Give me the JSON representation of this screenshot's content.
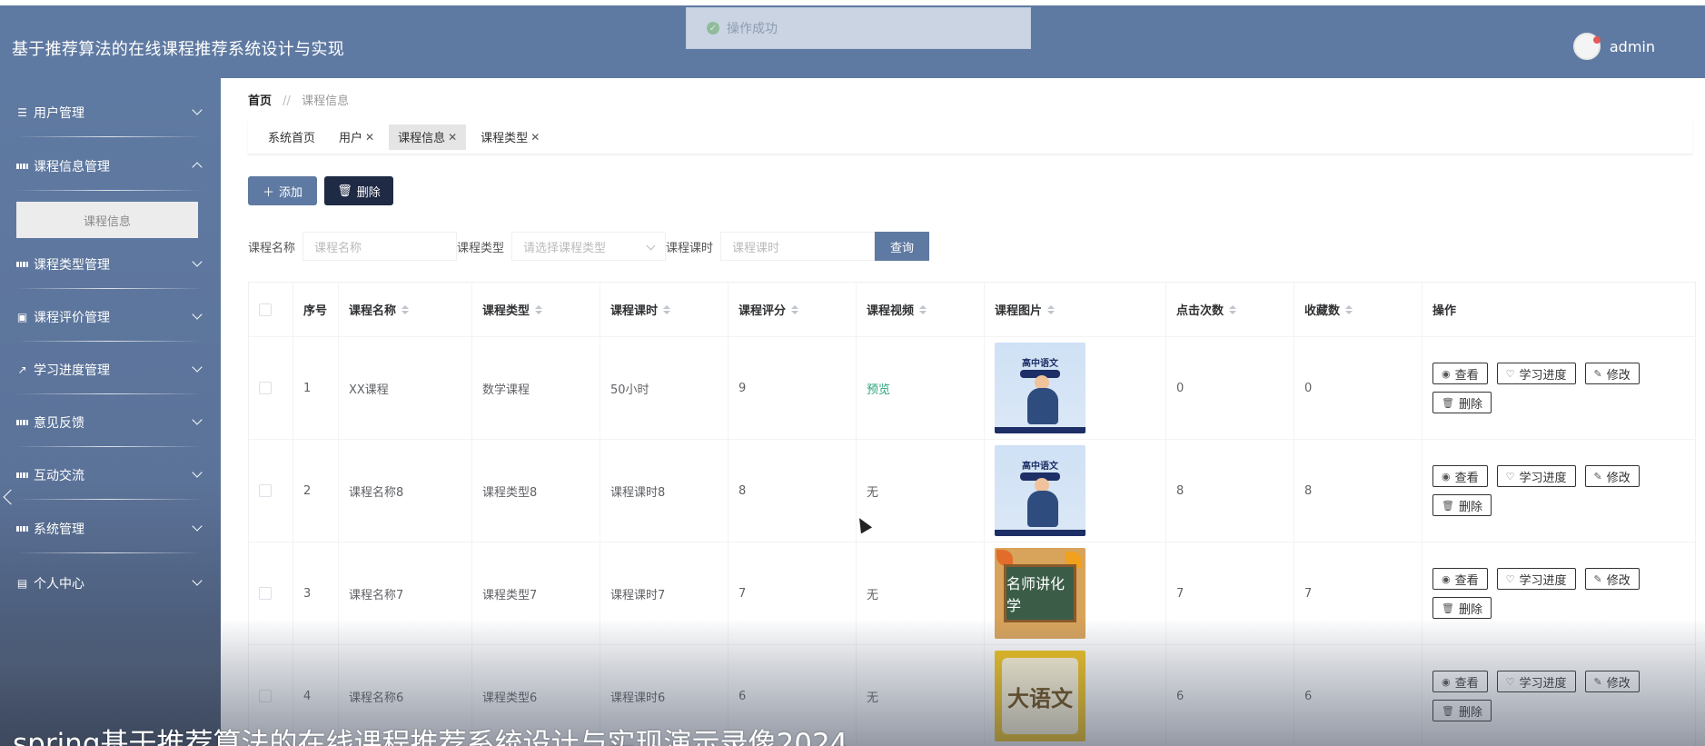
{
  "app": {
    "title": "基于推荐算法的在线课程推荐系统设计与实现",
    "user": "admin"
  },
  "toast": {
    "text": "操作成功"
  },
  "sidebar": {
    "items": [
      {
        "label": "用户管理",
        "icon": "sliders-icon",
        "expanded": false
      },
      {
        "label": "课程信息管理",
        "icon": "grid-icon",
        "expanded": true
      },
      {
        "label": "课程类型管理",
        "icon": "grid-icon",
        "expanded": false
      },
      {
        "label": "课程评价管理",
        "icon": "clipboard-icon",
        "expanded": false
      },
      {
        "label": "学习进度管理",
        "icon": "chart-icon",
        "expanded": false
      },
      {
        "label": "意见反馈",
        "icon": "grid-icon",
        "expanded": false
      },
      {
        "label": "互动交流",
        "icon": "grid-icon",
        "expanded": false
      },
      {
        "label": "系统管理",
        "icon": "grid-icon",
        "expanded": false
      },
      {
        "label": "个人中心",
        "icon": "calendar-icon",
        "expanded": false
      }
    ],
    "submenu": {
      "label": "课程信息"
    }
  },
  "breadcrumb": {
    "home": "首页",
    "sep": "//",
    "current": "课程信息"
  },
  "tabs": [
    {
      "label": "系统首页",
      "closable": false
    },
    {
      "label": "用户",
      "closable": true
    },
    {
      "label": "课程信息",
      "closable": true,
      "active": true
    },
    {
      "label": "课程类型",
      "closable": true
    }
  ],
  "toolbar": {
    "add_label": "添加",
    "delete_label": "删除"
  },
  "search": {
    "name_label": "课程名称",
    "name_placeholder": "课程名称",
    "type_label": "课程类型",
    "type_placeholder": "请选择课程类型",
    "hours_label": "课程课时",
    "hours_placeholder": "课程课时",
    "query_label": "查询"
  },
  "table": {
    "headers": [
      "序号",
      "课程名称",
      "课程类型",
      "课程课时",
      "课程评分",
      "课程视频",
      "课程图片",
      "点击次数",
      "收藏数",
      "操作"
    ],
    "actions": {
      "view": "查看",
      "progress": "学习进度",
      "edit": "修改",
      "delete": "删除"
    },
    "rows": [
      {
        "no": "1",
        "name": "XX课程",
        "type": "数学课程",
        "hours": "50小时",
        "score": "9",
        "video": "预览",
        "image": "高中语文",
        "clicks": "0",
        "favorites": "0"
      },
      {
        "no": "2",
        "name": "课程名称8",
        "type": "课程类型8",
        "hours": "课程课时8",
        "score": "8",
        "video": "无",
        "image": "高中语文",
        "clicks": "8",
        "favorites": "8"
      },
      {
        "no": "3",
        "name": "课程名称7",
        "type": "课程类型7",
        "hours": "课程课时7",
        "score": "7",
        "video": "无",
        "image": "名师讲化学",
        "clicks": "7",
        "favorites": "7"
      },
      {
        "no": "4",
        "name": "课程名称6",
        "type": "课程类型6",
        "hours": "课程课时6",
        "score": "6",
        "video": "无",
        "image": "大语文",
        "clicks": "6",
        "favorites": "6"
      }
    ]
  },
  "caption": "spring基于推荐算法的在线课程推荐系统设计与实现演示录像2024"
}
